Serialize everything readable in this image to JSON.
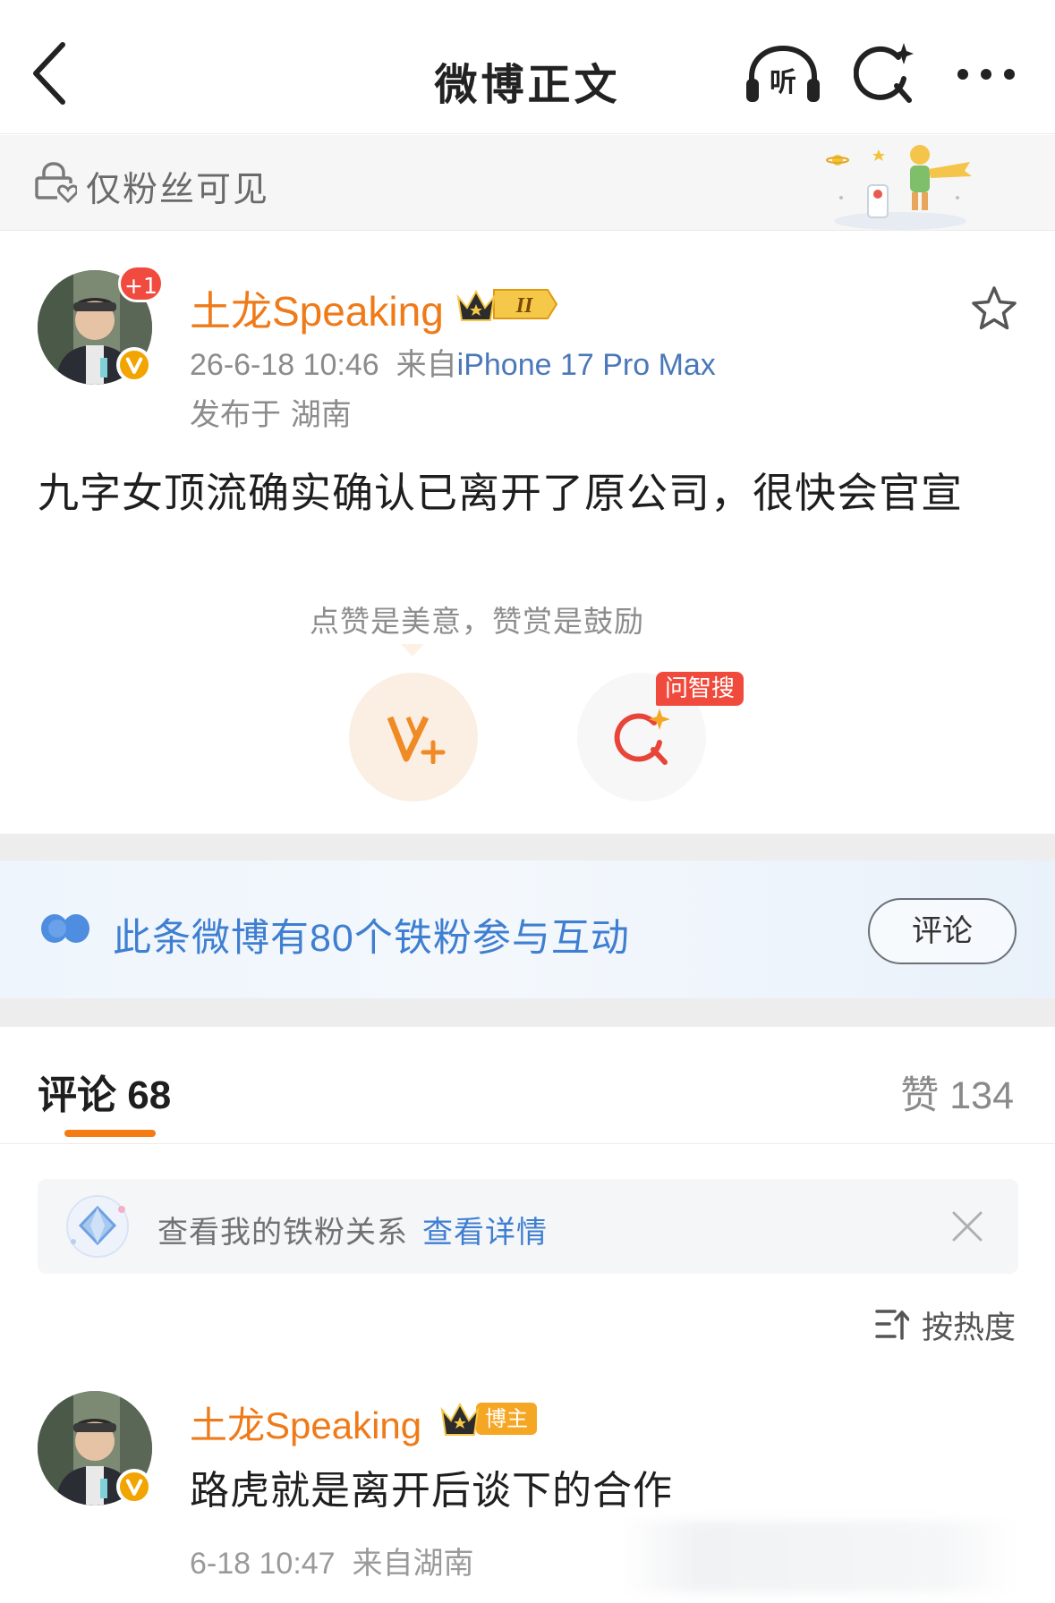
{
  "nav": {
    "title": "微博正文",
    "listen_label": "听",
    "back_icon": "chevron-left-icon",
    "search_icon": "ai-search-icon",
    "more_icon": "more-dots-icon"
  },
  "visibility": {
    "icon": "lock-heart-icon",
    "text": "仅粉丝可见"
  },
  "post": {
    "author": {
      "name": "土龙Speaking",
      "badge_icon": "crown-level-2-icon",
      "plus_badge": "+1",
      "verified_icon": "verified-v-icon"
    },
    "time": "26-6-18 10:46",
    "source_prefix": "来自",
    "device": "iPhone 17 Pro Max",
    "region": "发布于 湖南",
    "text": "九字女顶流确实确认已离开了原公司，很快会官宣",
    "reward": {
      "hint": "点赞是美意，赞赏是鼓励",
      "reward_icon": "v-plus-reward-icon",
      "search_icon": "ai-search-icon",
      "search_badge": "问智搜"
    }
  },
  "fans_strip": {
    "icon": "fans-toggle-icon",
    "text": "此条微博有80个铁粉参与互动",
    "button_label": "评论"
  },
  "tabs": {
    "comments_label": "评论",
    "comments_count": "68",
    "likes_label": "赞",
    "likes_count": "134"
  },
  "relation_banner": {
    "icon": "diamond-badge-icon",
    "text": "查看我的铁粉关系",
    "link": "查看详情",
    "close_icon": "close-icon"
  },
  "sort": {
    "icon": "sort-icon",
    "label": "按热度"
  },
  "comments": [
    {
      "author": "土龙Speaking",
      "badge": "博主",
      "text": "路虎就是离开后谈下的合作",
      "time": "6-18 10:47",
      "source": "来自湖南"
    }
  ],
  "colors": {
    "accent_orange": "#ef7a18",
    "link_blue": "#3f7fd1",
    "badge_red": "#f04a3c",
    "verified_gold": "#f2a400"
  }
}
